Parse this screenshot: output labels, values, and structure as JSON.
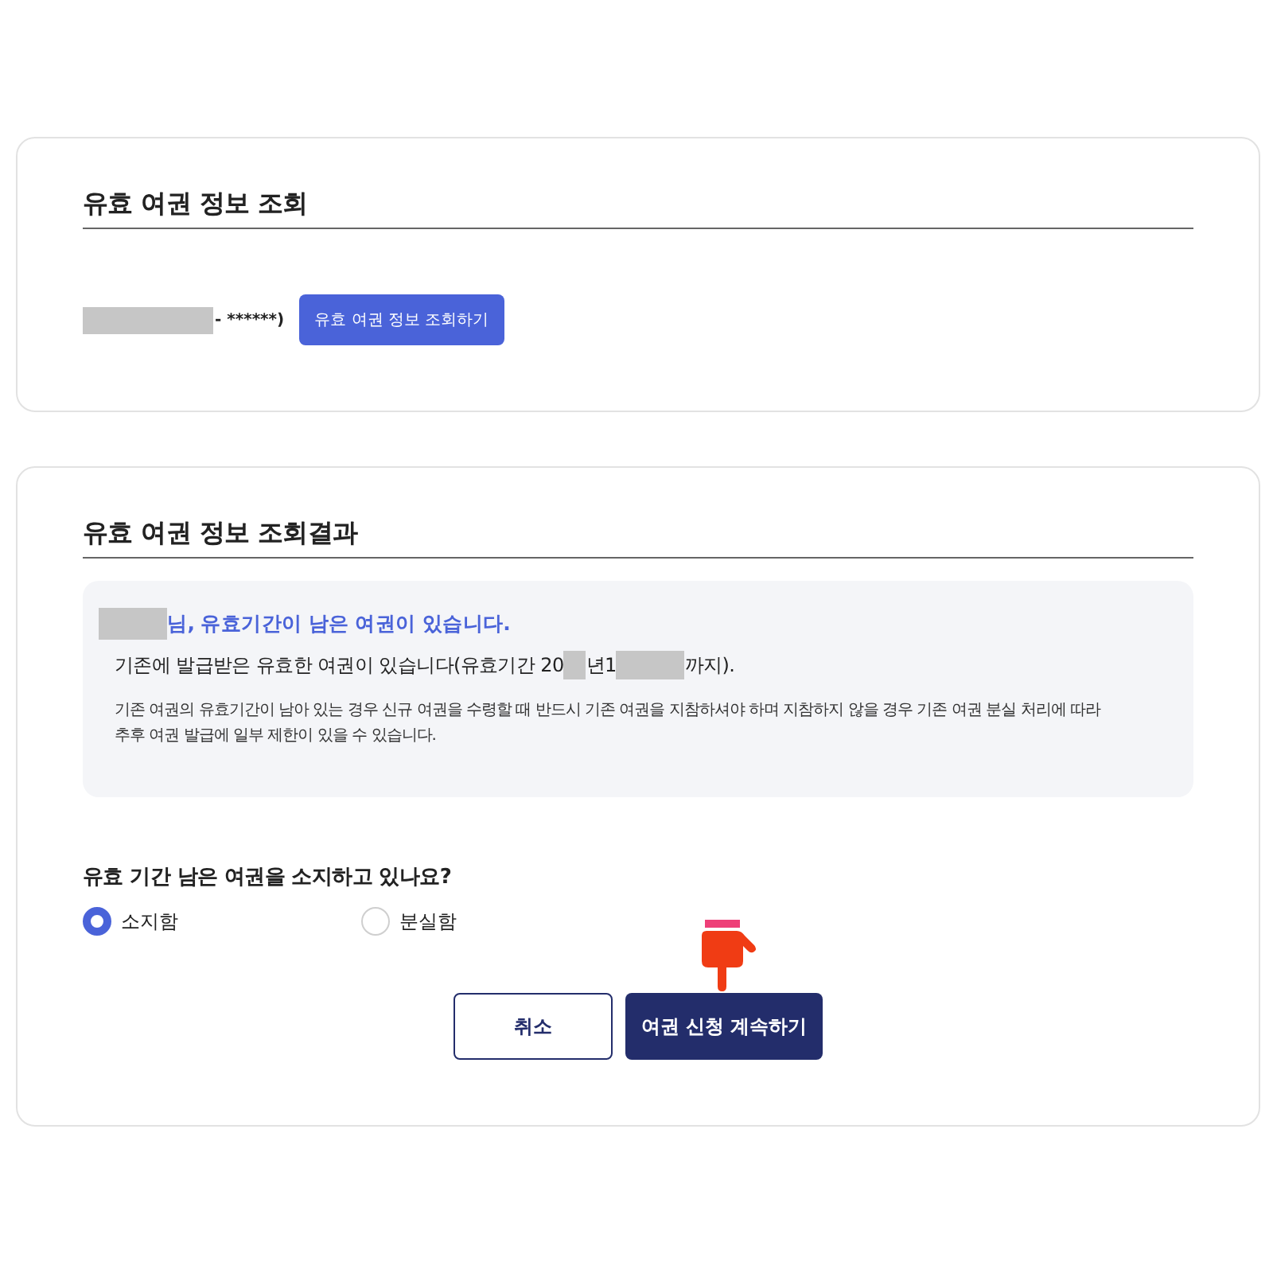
{
  "lookup_panel": {
    "title": "유효 여권 정보 조회",
    "id_parts": [
      {
        "kind": "redacted-id"
      },
      {
        "kind": "text",
        "text": "- ******)"
      }
    ],
    "lookup_button": "유효 여권 정보 조회하기"
  },
  "result_panel": {
    "title": "유효 여권 정보 조회결과",
    "notice": {
      "heading_parts": [
        {
          "kind": "redacted-name"
        },
        {
          "kind": "text",
          "text": "님, 유효기간이 남은 여권이 있습니다."
        }
      ],
      "detail_parts": [
        {
          "kind": "text",
          "text": "기존에 발급받은 유효한 여권이 있습니다(유효기간 20"
        },
        {
          "kind": "redacted-year"
        },
        {
          "kind": "text",
          "text": "년1"
        },
        {
          "kind": "redacted-date"
        },
        {
          "kind": "text",
          "text": "까지)."
        }
      ],
      "paragraph": "기존 여권의 유효기간이 남아 있는 경우 신규 여권을 수령할 때 반드시 기존 여권을 지참하셔야 하며 지참하지 않을 경우 기존 여권 분실 처리에 따라 추후 여권 발급에 일부 제한이 있을 수 있습니다."
    },
    "question": "유효 기간 남은 여권을 소지하고 있나요?",
    "options": [
      {
        "label": "소지함",
        "selected": true
      },
      {
        "label": "분실함",
        "selected": false
      }
    ],
    "buttons": [
      {
        "kind": "secondary",
        "label": "취소"
      },
      {
        "kind": "primary",
        "label": "여권 신청 계속하기"
      }
    ]
  }
}
